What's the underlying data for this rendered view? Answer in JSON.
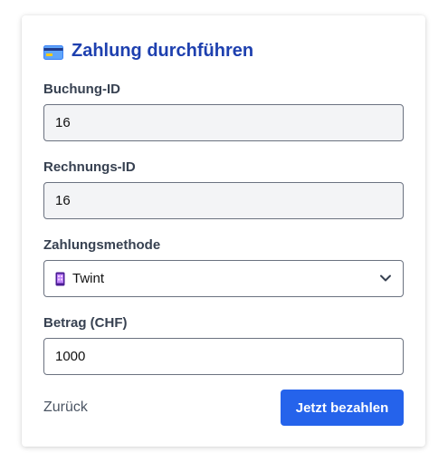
{
  "form": {
    "title": "Zahlung durchführen",
    "title_icon": "credit-card-icon",
    "booking_id": {
      "label": "Buchung-ID",
      "value": "16"
    },
    "invoice_id": {
      "label": "Rechnungs-ID",
      "value": "16"
    },
    "payment_method": {
      "label": "Zahlungsmethode",
      "value": "Twint",
      "icon": "mobile-phone-icon"
    },
    "amount": {
      "label": "Betrag (CHF)",
      "value": "1000"
    },
    "back_label": "Zurück",
    "submit_label": "Jetzt bezahlen"
  },
  "colors": {
    "title": "#1e40af",
    "primary_button": "#2563eb",
    "readonly_bg": "#f3f4f6"
  }
}
